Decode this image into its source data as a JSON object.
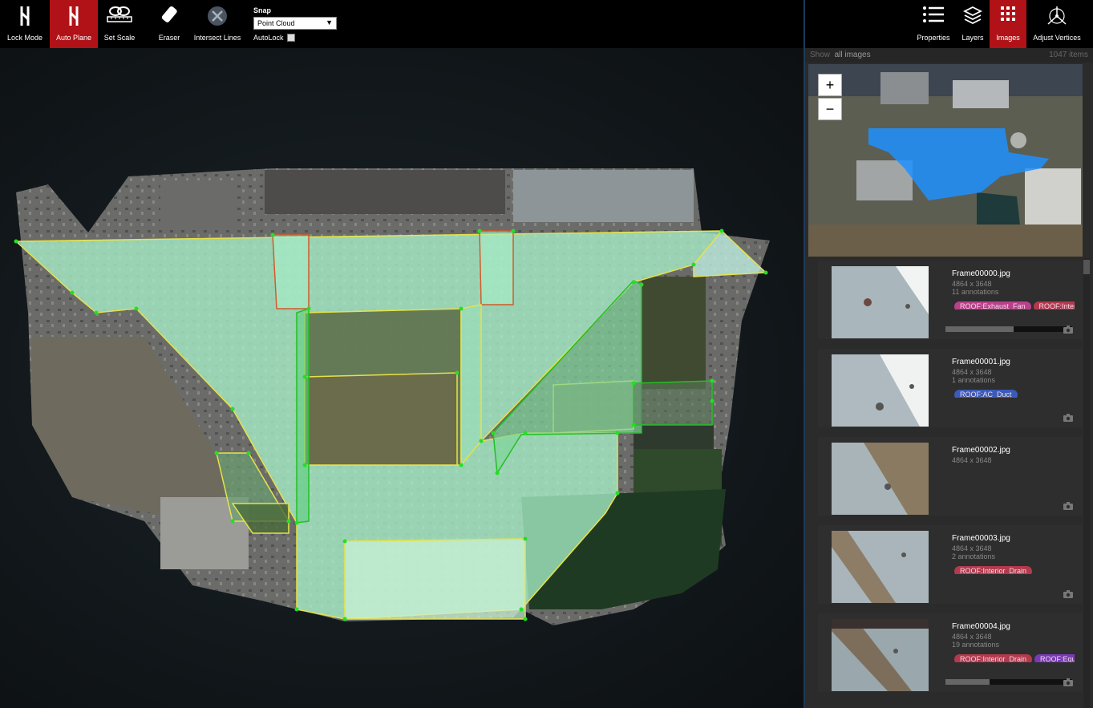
{
  "toolbar": {
    "tools": [
      {
        "label": "Lock Mode",
        "icon": "lock-mode-icon",
        "active": false
      },
      {
        "label": "Auto Plane",
        "icon": "auto-plane-icon",
        "active": true
      },
      {
        "label": "Set Scale",
        "icon": "set-scale-icon",
        "active": false
      },
      {
        "label": "Eraser",
        "icon": "eraser-icon",
        "active": false
      },
      {
        "label": "Intersect Lines",
        "icon": "intersect-lines-icon",
        "active": false
      }
    ],
    "snap_label": "Snap",
    "snap_value": "Point Cloud",
    "autolock_label": "AutoLock",
    "autolock_checked": false,
    "right_tools": [
      {
        "label": "Properties",
        "icon": "list-icon",
        "active": false
      },
      {
        "label": "Layers",
        "icon": "layers-icon",
        "active": false
      },
      {
        "label": "Images",
        "icon": "grid-icon",
        "active": true
      },
      {
        "label": "Adjust Vertices",
        "icon": "adjust-vertices-icon",
        "active": false
      }
    ]
  },
  "panel": {
    "show_label": "Show",
    "filter_value": "all images",
    "count": "1047 items",
    "zoom_in": "+",
    "zoom_out": "−",
    "images": [
      {
        "name": "Frame00000.jpg",
        "dims": "4864 x 3648",
        "annotations": "11 annotations",
        "tags": [
          {
            "text": "ROOF:Exhaust_Fan",
            "color": "#b8418a"
          },
          {
            "text": "ROOF:Interior_Drain",
            "color": "#b33a4e"
          }
        ],
        "progress": 0.54
      },
      {
        "name": "Frame00001.jpg",
        "dims": "4864 x 3648",
        "annotations": "1 annotations",
        "tags": [
          {
            "text": "ROOF:AC_Duct",
            "color": "#3a5bb8"
          }
        ],
        "progress": null
      },
      {
        "name": "Frame00002.jpg",
        "dims": "4864 x 3648",
        "annotations": "",
        "tags": [],
        "progress": null
      },
      {
        "name": "Frame00003.jpg",
        "dims": "4864 x 3648",
        "annotations": "2 annotations",
        "tags": [
          {
            "text": "ROOF:Interior_Drain",
            "color": "#b33a4e"
          }
        ],
        "progress": null
      },
      {
        "name": "Frame00004.jpg",
        "dims": "4864 x 3648",
        "annotations": "19 annotations",
        "tags": [
          {
            "text": "ROOF:Interior_Drain",
            "color": "#b33a4e"
          },
          {
            "text": "ROOF:Equipment",
            "color": "#7a3ab8"
          }
        ],
        "progress": 0.35
      }
    ]
  },
  "colors": {
    "accent": "#b01217",
    "plane_fill": "#a8f0c8",
    "plane_edge": "#e6e24a",
    "vertex": "#22e022",
    "selection": "#1e90ff"
  }
}
